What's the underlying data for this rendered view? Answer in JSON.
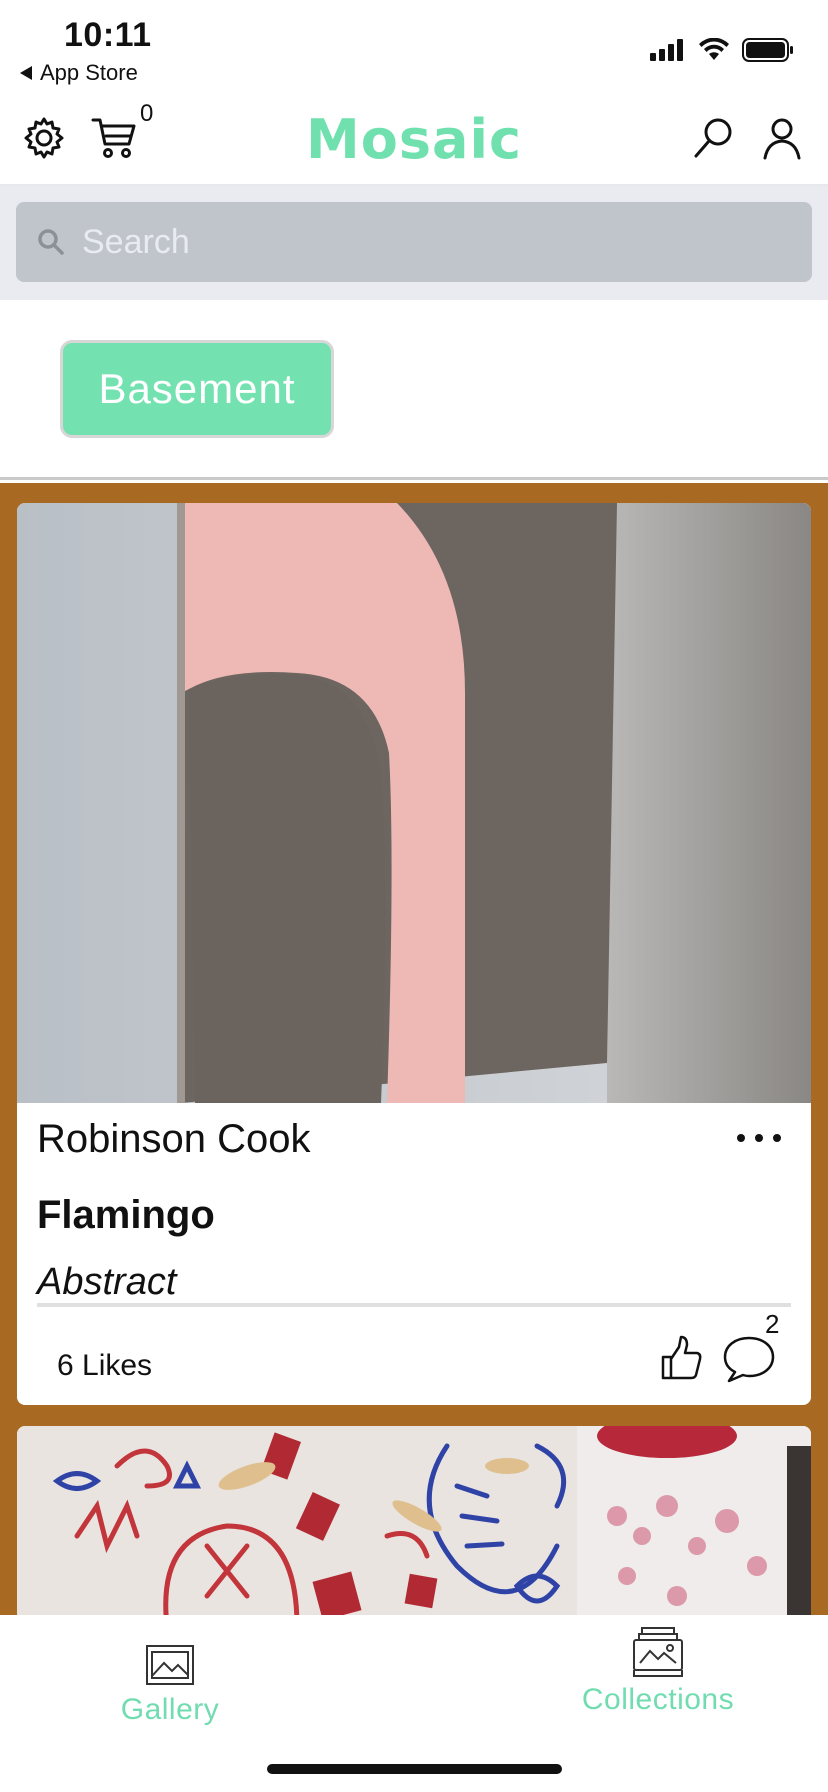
{
  "status_bar": {
    "time": "10:11",
    "back_label": "App Store"
  },
  "header": {
    "cart_count": "0",
    "logo": "Mosaic",
    "icons": [
      "gear-icon",
      "cart-icon",
      "search-icon",
      "user-icon"
    ]
  },
  "search": {
    "placeholder": "Search",
    "value": ""
  },
  "filters": {
    "active_chip": "Basement"
  },
  "feed": {
    "background_color": "#a86a22",
    "posts": [
      {
        "artist": "Robinson Cook",
        "title": "Flamingo",
        "style": "Abstract",
        "likes_label": "6 Likes",
        "comment_count": "2"
      }
    ]
  },
  "bottom_nav": {
    "gallery_label": "Gallery",
    "collections_label": "Collections"
  },
  "colors": {
    "accent": "#72dcb1",
    "chip": "#74e2b0"
  }
}
